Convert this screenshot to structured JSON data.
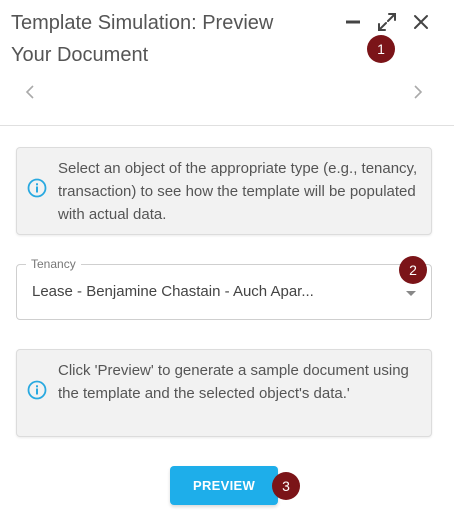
{
  "dialog": {
    "title_line1": "Template Simulation: Preview",
    "title_line2": "Your Document"
  },
  "window_controls": {
    "minimize_icon": "minimize-icon",
    "expand_icon": "expand-icon",
    "close_icon": "close-icon"
  },
  "badges": [
    "1",
    "2",
    "3"
  ],
  "nav": {
    "prev_icon": "chevron-left-icon",
    "next_icon": "chevron-right-icon"
  },
  "info_1": {
    "icon": "info-icon",
    "text": "Select an object of the appropriate type (e.g., tenancy, transaction) to see how the template will be populated with actual data."
  },
  "select": {
    "label": "Tenancy",
    "value": "Lease - Benjamine  Chastain - Auch Apar...",
    "arrow_icon": "dropdown-arrow-icon"
  },
  "info_2": {
    "icon": "info-icon",
    "text": "Click 'Preview' to generate a sample document using the template and the selected object's data.'"
  },
  "preview_button": {
    "label": "PREVIEW"
  },
  "colors": {
    "accent": "#1eaeea",
    "badge": "#7b1418",
    "info_icon": "#29a9e0",
    "info_bg": "#f2f2f2"
  }
}
